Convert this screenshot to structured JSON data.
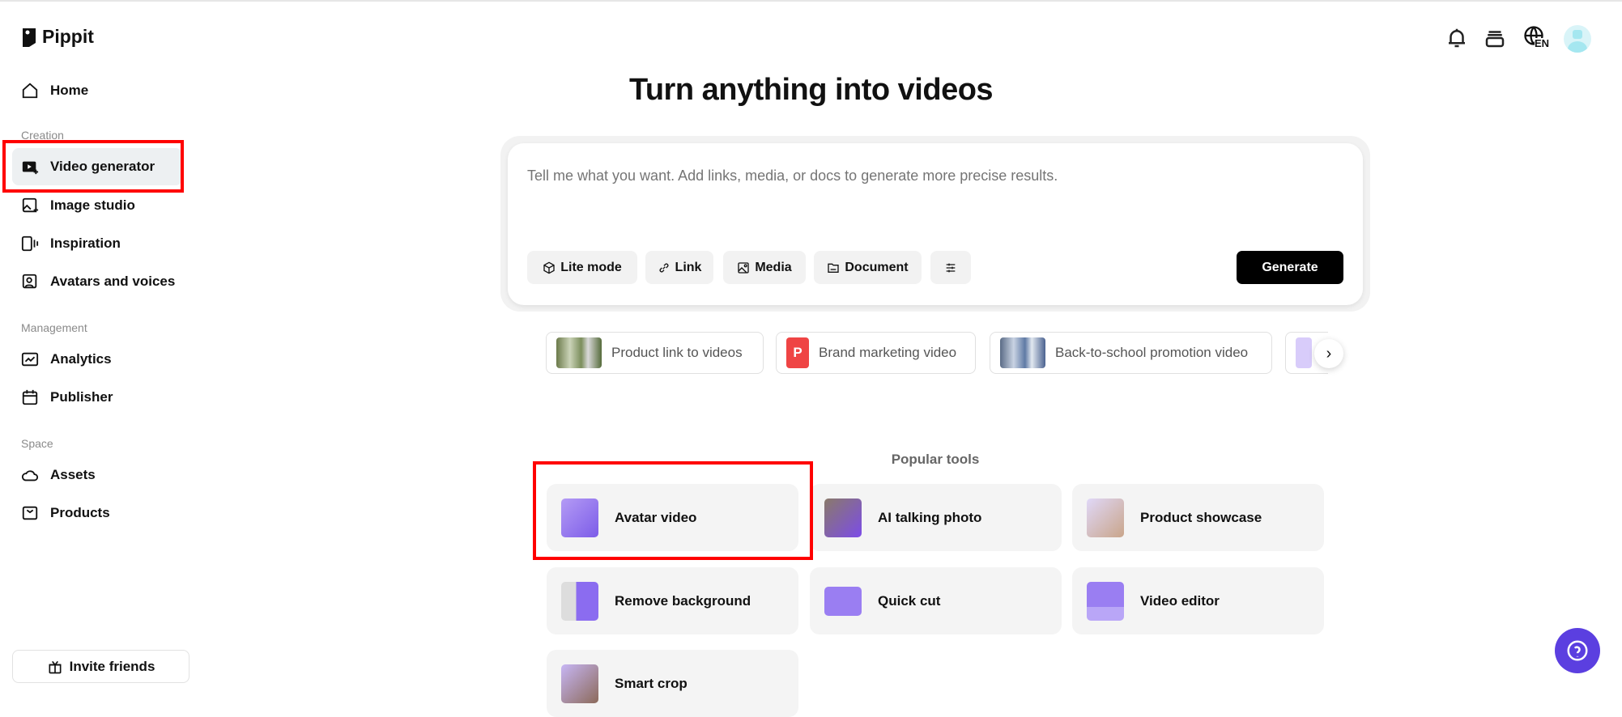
{
  "app": {
    "name": "Pippit"
  },
  "sidebar": {
    "home": "Home",
    "sections": {
      "creation": "Creation",
      "management": "Management",
      "space": "Space"
    },
    "items": {
      "video_generator": "Video generator",
      "image_studio": "Image studio",
      "inspiration": "Inspiration",
      "avatars": "Avatars and voices",
      "analytics": "Analytics",
      "publisher": "Publisher",
      "assets": "Assets",
      "products": "Products"
    },
    "invite": "Invite friends"
  },
  "header": {
    "language": "EN"
  },
  "main": {
    "title": "Turn anything into videos",
    "prompt_placeholder": "Tell me what you want. Add links, media, or docs to generate more precise results.",
    "buttons": {
      "lite": "Lite mode",
      "link": "Link",
      "media": "Media",
      "document": "Document",
      "generate": "Generate"
    },
    "chips": [
      "Product link to videos",
      "Brand marketing video",
      "Back-to-school promotion video"
    ],
    "chip_p": "P",
    "popular_label": "Popular tools",
    "tools": [
      "Avatar video",
      "AI talking photo",
      "Product showcase",
      "Remove background",
      "Quick cut",
      "Video editor",
      "Smart crop"
    ]
  },
  "colors": {
    "accent": "#5b3fe0",
    "highlight": "#ff0000"
  }
}
